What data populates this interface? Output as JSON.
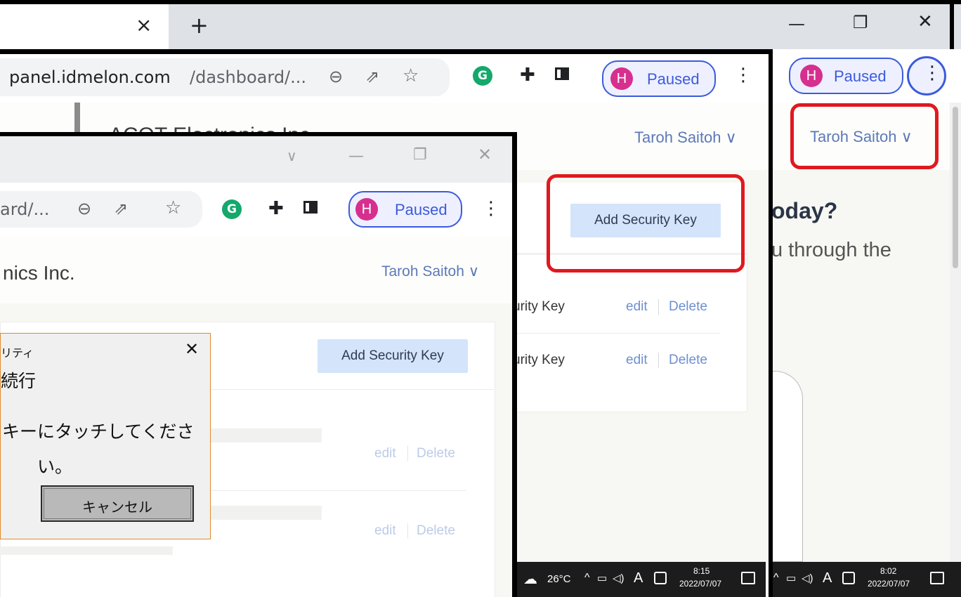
{
  "back_window": {
    "tab_close": "×",
    "new_tab": "+",
    "tab_search": "∨",
    "minimize": "—",
    "maximize": "❐",
    "close": "✕",
    "profile_initial": "H",
    "profile_status": "Paused",
    "user_menu": "Taroh Saitoh ∨",
    "heading_fragment": "oday?",
    "subtext_fragment": "u through the",
    "taskbar": {
      "time": "8:02",
      "date": "2022/07/07"
    }
  },
  "middle_window": {
    "tab_search": "∨",
    "minimize": "—",
    "maximize": "❐",
    "close": "✕",
    "url_host": "panel.idmelon.com",
    "url_path": "/dashboard/...",
    "profile_initial": "H",
    "profile_status": "Paused",
    "company": "ACOT Electronics Inc.",
    "user_menu": "Taroh Saitoh ∨",
    "add_key_button": "Add Security Key",
    "keys": [
      {
        "name_fragment": "urity Key",
        "edit": "edit",
        "delete": "Delete"
      },
      {
        "name_fragment": "urity Key",
        "edit": "edit",
        "delete": "Delete"
      }
    ],
    "taskbar": {
      "temperature": "26°C",
      "ime": "A",
      "time": "8:15",
      "date": "2022/07/07"
    }
  },
  "front_window": {
    "tab_search": "∨",
    "minimize": "—",
    "maximize": "❐",
    "close": "✕",
    "url_fragment": "ard/...",
    "profile_initial": "H",
    "profile_status": "Paused",
    "company_fragment": "nics Inc.",
    "user_menu": "Taroh Saitoh ∨",
    "add_key_button": "Add Security Key",
    "keys": [
      {
        "edit": "edit",
        "delete": "Delete"
      },
      {
        "edit": "edit",
        "delete": "Delete"
      }
    ]
  },
  "dialog": {
    "title_fragment": "リティ",
    "close": "✕",
    "heading_fragment": "続行",
    "message_line1": "キーにタッチしてくださ",
    "message_line2": "い。",
    "cancel_button": "キャンセル"
  },
  "colors": {
    "highlight_red": "#e0191f",
    "profile_blue": "#3b5bdb",
    "avatar_pink": "#d62f8e",
    "button_blue": "#d3e4fb",
    "link_blue": "#6d8fd1"
  }
}
